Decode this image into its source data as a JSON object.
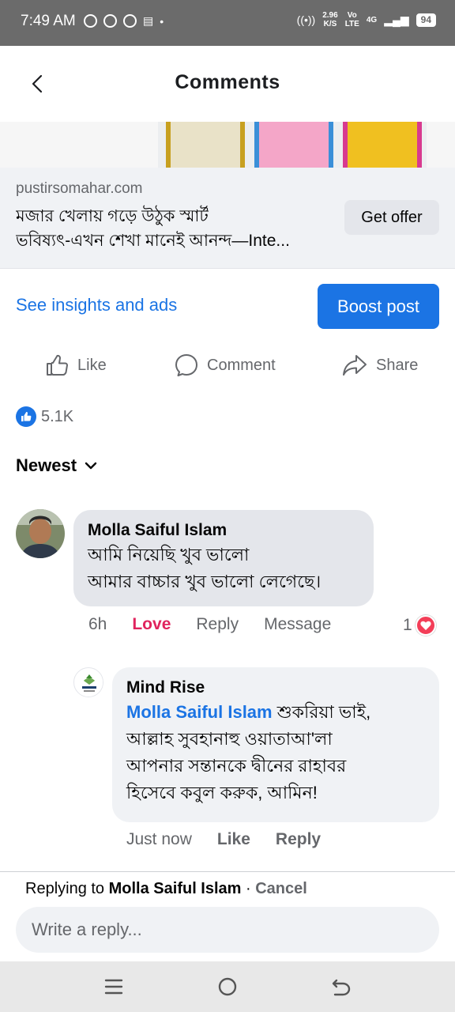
{
  "status_bar": {
    "time": "7:49 AM",
    "speed_value": "2.96",
    "speed_unit": "K/S",
    "volte_top": "Vo",
    "volte_bottom": "LTE",
    "network": "4G",
    "battery": "94"
  },
  "header": {
    "title": "Comments",
    "back_icon": "chevron-left-icon"
  },
  "ad": {
    "domain": "pustirsomahar.com",
    "headline_line1": "মজার খেলায় গড়ে উঠুক স্মার্ট",
    "headline_line2": "ভবিষ্যৎ-এখন শেখা মানেই আনন্দ—Inte...",
    "cta": "Get offer"
  },
  "post_actions": {
    "insights_link": "See insights and ads",
    "boost_button": "Boost post",
    "like": "Like",
    "comment": "Comment",
    "share": "Share"
  },
  "reactions": {
    "count": "5.1K"
  },
  "sort": {
    "label": "Newest"
  },
  "comments": [
    {
      "author": "Molla Saiful Islam",
      "line1": "আমি নিয়েছি খুব ভালো",
      "line2": "আমার বাচ্চার খুব ভালো লেগেছে।",
      "time": "6h",
      "reaction_label": "Love",
      "reply": "Reply",
      "message": "Message",
      "reaction_count": "1"
    }
  ],
  "reply": {
    "author": "Mind Rise",
    "mention": "Molla Saiful Islam",
    "text_after_mention": " শুকরিয়া ভাই,",
    "line2": "আল্লাহ সুবহানাহু ওয়াতাআ'লা",
    "line3": "আপনার সন্তানকে দ্বীনের রাহাবর",
    "line4": "হিসেবে কবুল করুক, আমিন!",
    "time": "Just now",
    "like": "Like",
    "reply": "Reply"
  },
  "composer": {
    "replying_prefix": "Replying to ",
    "replying_name": "Molla Saiful Islam",
    "separator": " · ",
    "cancel": "Cancel",
    "placeholder": "Write a reply..."
  },
  "colors": {
    "accent": "#1b74e4",
    "love": "#e0245e",
    "muted": "#65676b",
    "bubble": "#f0f2f5"
  }
}
